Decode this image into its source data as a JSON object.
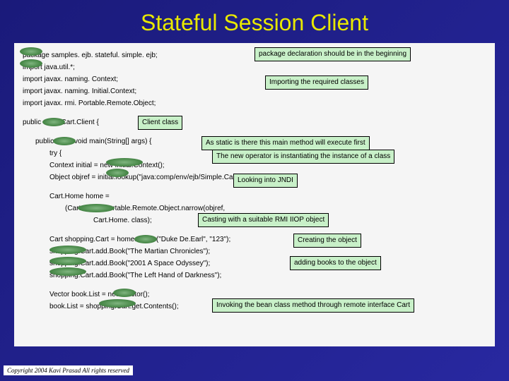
{
  "title": "Stateful Session Client",
  "code": {
    "l1": "package samples. ejb. stateful. simple. ejb;",
    "l2": "import java.util.*;",
    "l3": "import javax. naming. Context;",
    "l4": "import javax. naming. Initial.Context;",
    "l5": "import javax. rmi. Portable.Remote.Object;",
    "l6": "public class Cart.Client {",
    "l7": "public static void main(String[] args) {",
    "l8": "try {",
    "l9": "Context initial = new Initial.Context();",
    "l10": "Object objref = initial.lookup(\"java:comp/env/ejb/Simple.Cart\");",
    "l11": "Cart.Home home =",
    "l12": "(Cart.Home)Portable.Remote.Object.narrow(objref,",
    "l13": "Cart.Home. class);",
    "l14": "Cart shopping.Cart = home.create(\"Duke De.Earl\", \"123\");",
    "l15": "shopping.Cart.add.Book(\"The Martian Chronicles\");",
    "l16": "shopping.Cart.add.Book(\"2001 A Space Odyssey\");",
    "l17": "shopping.Cart.add.Book(\"The Left Hand of Darkness\");",
    "l18": "Vector book.List = new Vector();",
    "l19": "book.List = shopping.Cart.get.Contents();"
  },
  "annotations": {
    "a1": "package declaration should be in the beginning",
    "a2": "Importing the required classes",
    "a3": "Client class",
    "a4": "As static is there this main method will execute first",
    "a5": "The new operator is instantiating the instance of a  class",
    "a6": "Looking  into JNDI",
    "a7": "Casting with a suitable RMI IIOP object",
    "a8": "Creating the object",
    "a9": "adding books to the object",
    "a10": "Invoking the bean class method through remote interface Cart"
  },
  "copyright": "Copyright 2004 Kavi Prasad All rights reserved"
}
